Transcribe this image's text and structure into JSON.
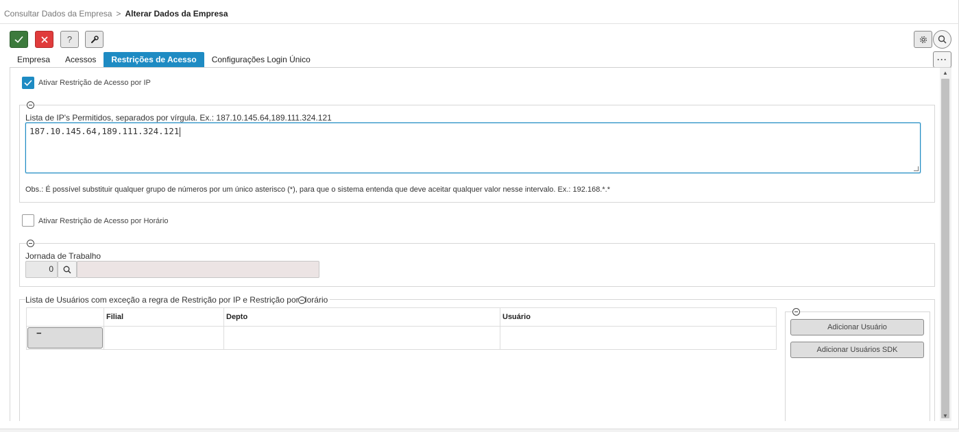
{
  "breadcrumb": {
    "parent": "Consultar Dados da Empresa",
    "separator": ">",
    "current": "Alterar Dados da Empresa"
  },
  "toolbar": {
    "confirm_icon": "check-icon",
    "cancel_icon": "close-icon",
    "help_label": "?",
    "tool_icon": "wrench-icon",
    "settings_icon": "gear-icon",
    "search_icon": "search-icon",
    "more_label": "···"
  },
  "tabs": [
    {
      "label": "Empresa",
      "active": false
    },
    {
      "label": "Acessos",
      "active": false
    },
    {
      "label": "Restrições de Acesso",
      "active": true
    },
    {
      "label": "Configurações Login Único",
      "active": false
    }
  ],
  "ip_restriction": {
    "checkbox_label": "Ativar Restrição de Acesso por IP",
    "checked": true,
    "list_label": "Lista de IP's Permitidos, separados por vírgula. Ex.: 187.10.145.64,189.111.324.121",
    "list_value": "187.10.145.64,189.111.324.121",
    "obs": "Obs.: É possível substituir qualquer grupo de números por um único asterisco (*), para que o sistema entenda que deve aceitar qualquer valor nesse intervalo. Ex.: 192.168.*.*"
  },
  "time_restriction": {
    "checkbox_label": "Ativar Restrição de Acesso por Horário",
    "checked": false,
    "jornada_label": "Jornada de Trabalho",
    "jornada_code": "0",
    "jornada_description": ""
  },
  "exceptions": {
    "legend": "Lista de Usuários com exceção a regra de Restrição por IP e Restrição por Horário",
    "columns": [
      "",
      "Filial",
      "Depto",
      "Usuário"
    ],
    "rows": [
      {
        "action_label": "−",
        "filial": "",
        "depto": "",
        "usuario": ""
      }
    ],
    "add_user_label": "Adicionar Usuário",
    "add_sdk_label": "Adicionar Usuários SDK"
  },
  "colors": {
    "accent": "#1e8bc3",
    "confirm": "#3c7a3c",
    "cancel": "#e03c3c"
  }
}
